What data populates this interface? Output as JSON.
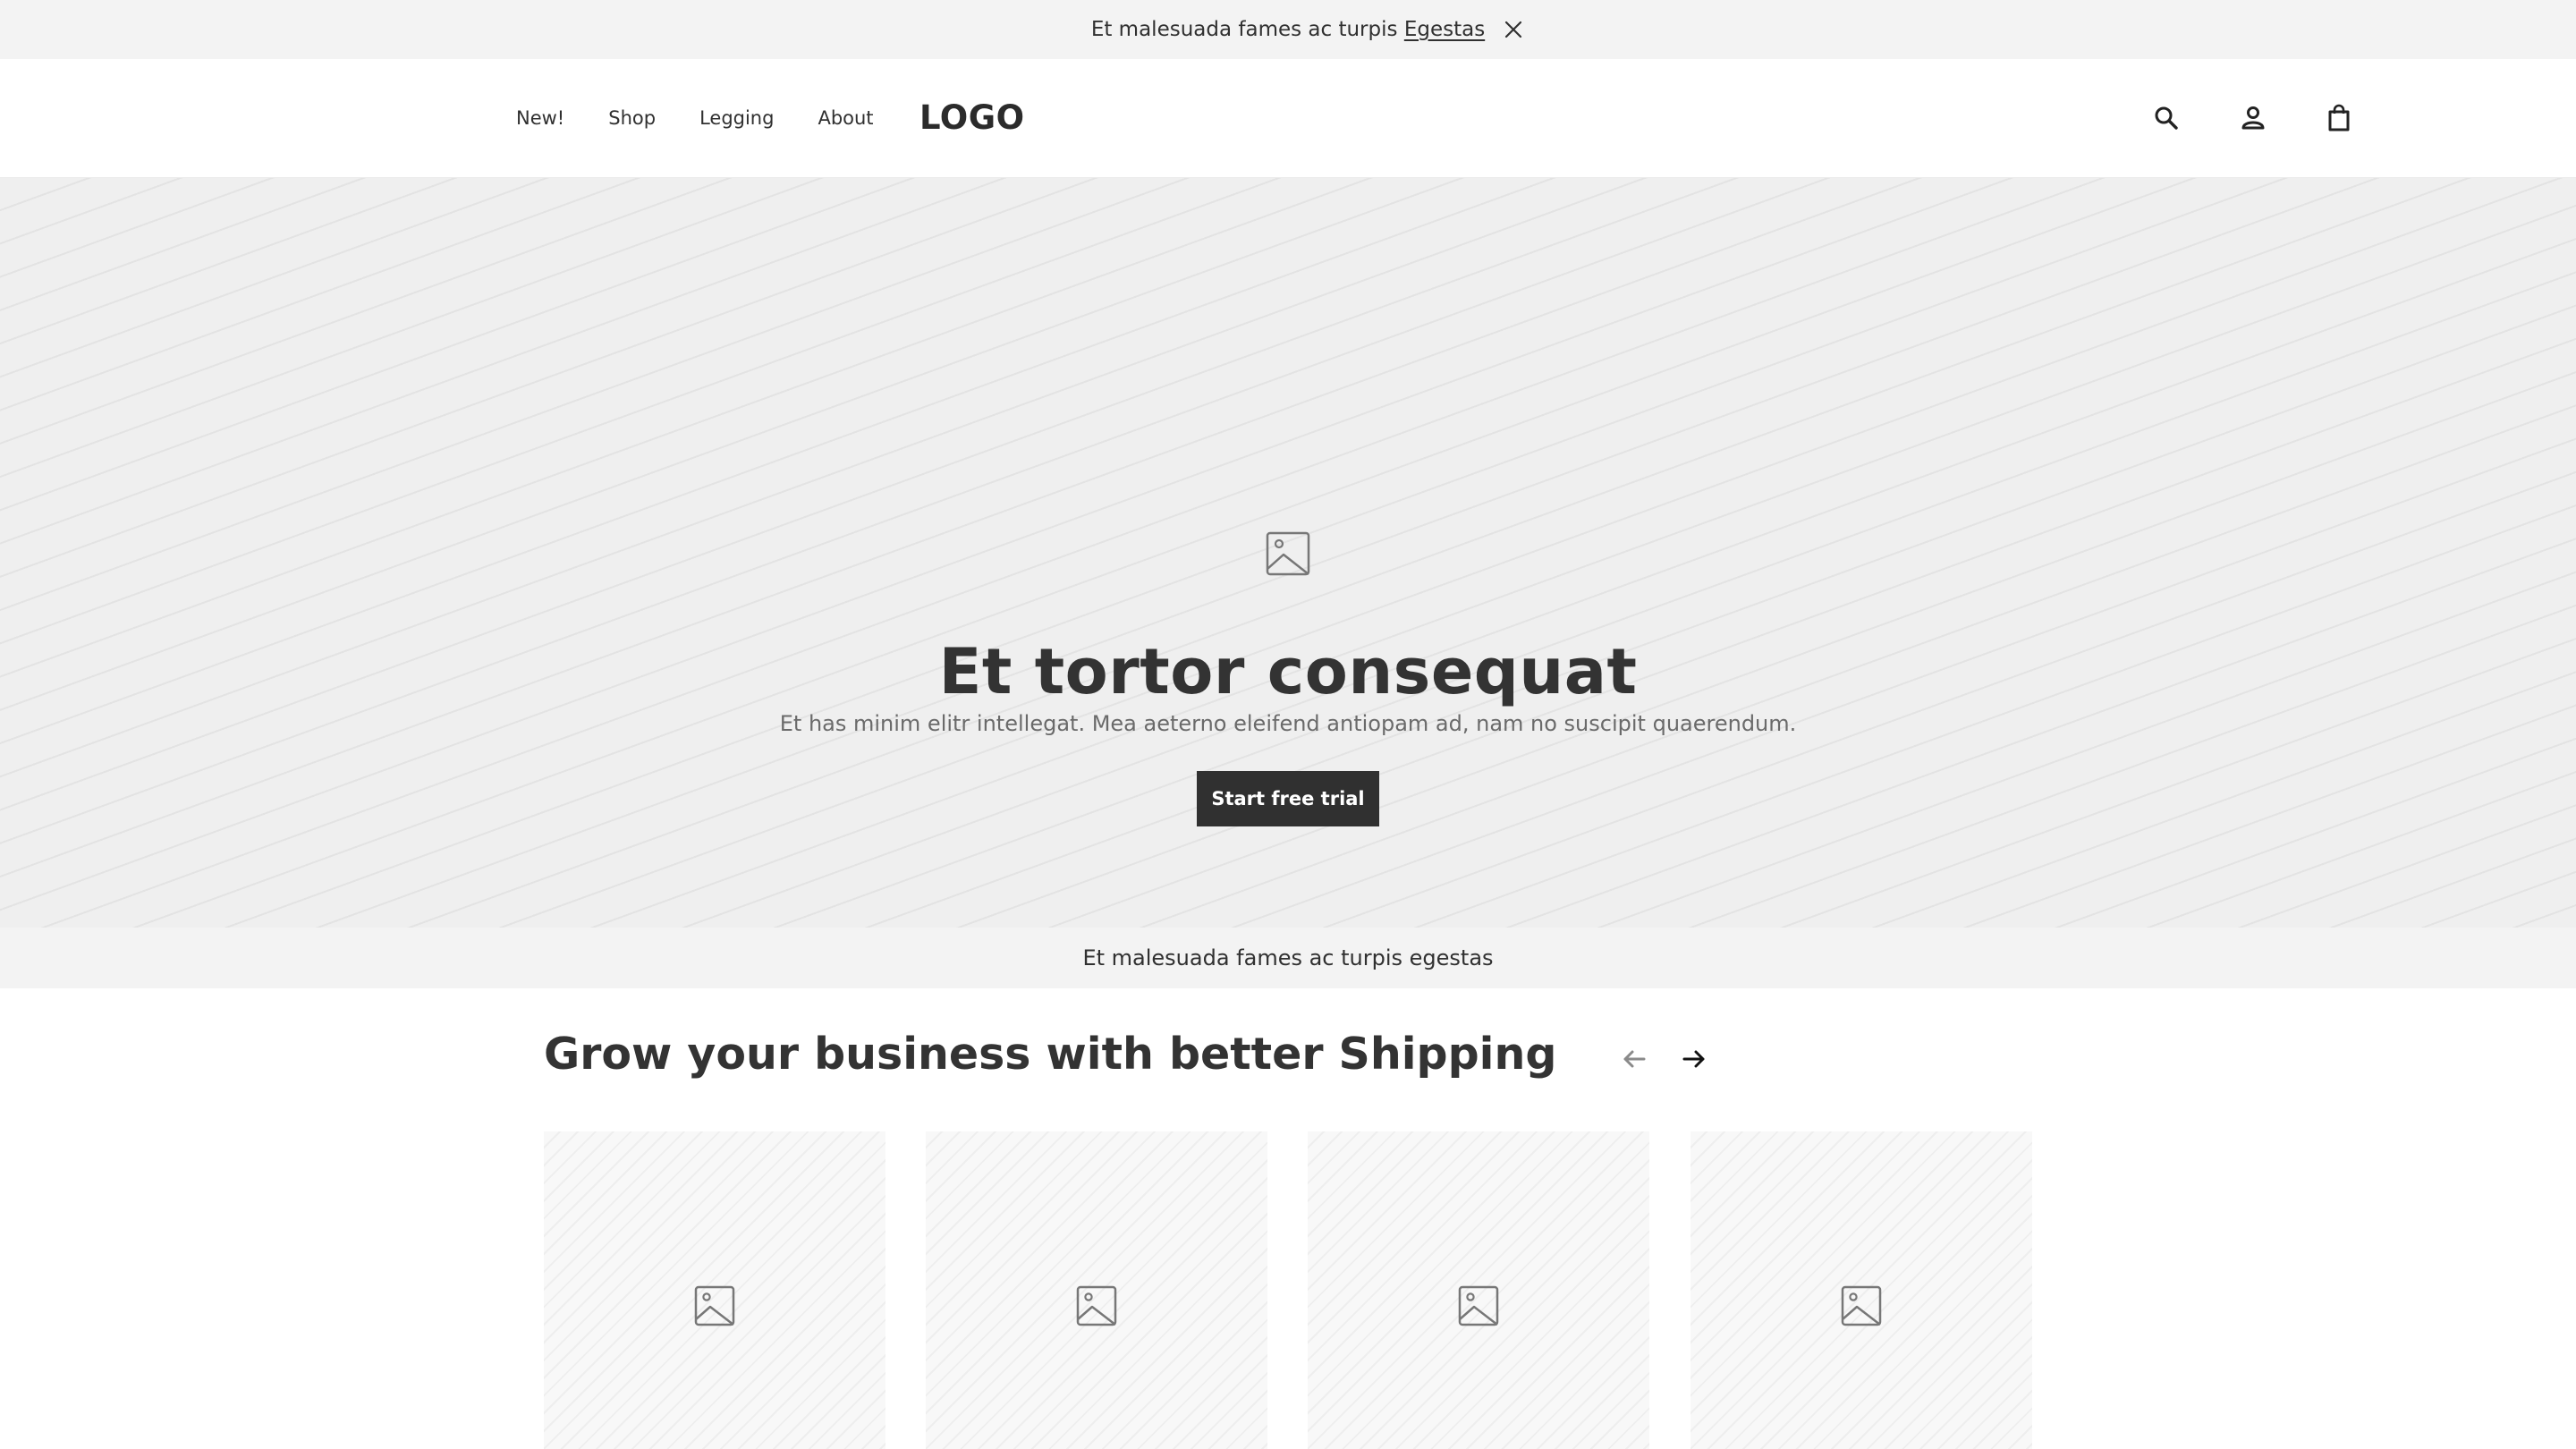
{
  "announcement": {
    "text": "Et malesuada fames ac turpis ",
    "link": "Egestas"
  },
  "header": {
    "nav": [
      "New!",
      "Shop",
      "Legging",
      "About"
    ],
    "logo": "LOGO",
    "icons": [
      "search-icon",
      "account-icon",
      "shopping-bag-icon"
    ]
  },
  "hero": {
    "image_icon": "image-placeholder-icon",
    "title": "Et tortor consequat",
    "subtitle": "Et has minim elitr intellegat. Mea aeterno eleifend antiopam ad, nam no suscipit quaerendum.",
    "cta": "Start free trial"
  },
  "strip": {
    "text": "Et malesuada fames ac turpis egestas"
  },
  "products": {
    "title": "Grow your business with better Shipping",
    "prev_icon": "arrow-left-icon",
    "next_icon": "arrow-right-icon",
    "card_icon": "image-placeholder-icon"
  },
  "colors": {
    "dark": "#303030",
    "hero_bg": "#efefef",
    "strip_bg": "#f3f3f3",
    "muted_text": "#6a6a6a"
  }
}
